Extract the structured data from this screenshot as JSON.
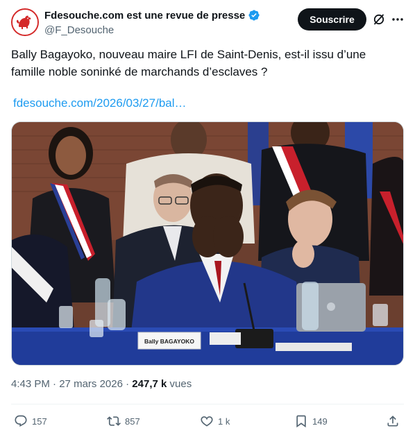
{
  "author": {
    "display_name": "Fdesouche.com est une revue de presse",
    "handle": "@F_Desouche",
    "verified": true,
    "avatar_icon": "rooster-icon",
    "brand_color": "#d42a2a"
  },
  "header": {
    "subscribe_label": "Souscrire",
    "grok_icon": "grok-icon",
    "more_icon": "more-icon"
  },
  "tweet": {
    "text": "Bally Bagayoko, nouveau maire LFI de Saint-Denis, est-il issu d’une famille noble soninké de marchands d’esclaves ?",
    "link_text": "fdesouche.com/2026/03/27/bal…",
    "link_color": "#1d9bf0"
  },
  "photo": {
    "placard_text": "Bally BAGAYOKO"
  },
  "meta": {
    "time": "4:43 PM",
    "separator": " · ",
    "date": "27 mars 2026",
    "views_count": "247,7 k",
    "views_label": "vues"
  },
  "actions": {
    "replies": "157",
    "reposts": "857",
    "likes": "1 k",
    "bookmarks": "149"
  }
}
